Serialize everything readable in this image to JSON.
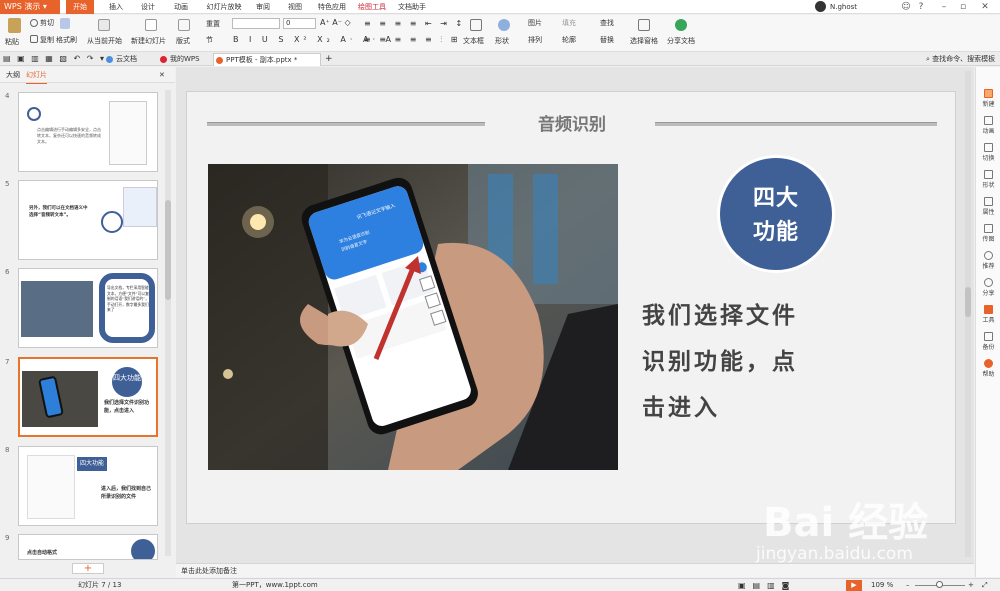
{
  "app": {
    "name": "WPS 演示"
  },
  "menu": {
    "tabs": [
      "开始",
      "插入",
      "设计",
      "动画",
      "幻灯片放映",
      "审阅",
      "视图",
      "特色应用",
      "绘图工具",
      "文档助手"
    ]
  },
  "user": {
    "name": "N.ghost"
  },
  "ribbon": {
    "paste": "粘贴",
    "cut": "剪切",
    "copy": "复制",
    "format_painter": "格式刷",
    "from_current": "从当前开始",
    "new_slide": "新建幻灯片",
    "layout": "版式",
    "reset": "重置",
    "section": "节",
    "font_size": "0",
    "textbox": "文本框",
    "shape": "形状",
    "arrange": "排列",
    "picture": "图片",
    "fill": "填充",
    "outline": "轮廓",
    "find": "查找",
    "replace": "替换",
    "select_pane": "选择窗格",
    "share_doc": "分享文档"
  },
  "toolbar": {
    "tabs": [
      "云文档",
      "我的WPS",
      "PPT模板 - 副本.pptx *"
    ],
    "search": "查找命令、搜索模板"
  },
  "panel": {
    "outline_tab": "大纲",
    "slides_tab": "幻灯片"
  },
  "slides": {
    "numbers": [
      "4",
      "5",
      "6",
      "7",
      "8",
      "9"
    ],
    "s4_text": "点击编辑进行手动编辑多安全，点击转文本，复杂还可以快速的音频转成文本。",
    "s5_text": "另外，我们可以在文档语义中选择“音频转文本”。",
    "s6_text": "导出文档，专栏采用智能文本，方便“文件”可以复制的话语“我们讲话的”，手动打开，数字最多我们来了",
    "s7_badge": "四大功能",
    "s7_text": "我们选择文件识别功能，点击进入",
    "s8_badge": "四大功能",
    "s8_text": "进入后，我们找到自己所录识别的文件",
    "s9_text": "点击自动格式"
  },
  "slide": {
    "title": "音频识别",
    "badge": [
      "四大",
      "功能"
    ],
    "body": [
      "我们选择文件",
      "识别功能，点",
      "击进入"
    ]
  },
  "phone": {
    "header": "讯飞语记文字输入",
    "card_line1": "华为云语音识别",
    "card_line2": "识别语音文字"
  },
  "notes": {
    "placeholder": "单击此处添加备注"
  },
  "status": {
    "slide_counter": "幻灯片 7 / 13",
    "template": "第一PPT，www.1ppt.com",
    "zoom": "109 %"
  },
  "right_panel": [
    "新建",
    "动画",
    "切换",
    "形状",
    "属性",
    "传图",
    "推荐",
    "分享",
    "工具",
    "备份",
    "帮助"
  ],
  "watermark": {
    "main": "Bai 经验",
    "sub": "jingyan.baidu.com"
  }
}
